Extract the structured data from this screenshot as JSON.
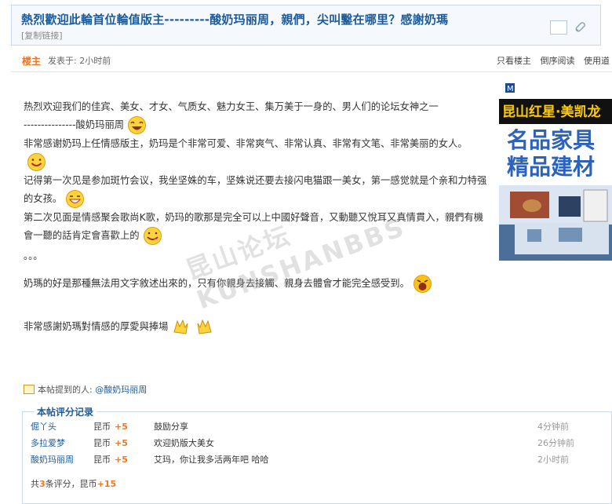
{
  "thread": {
    "title": "熱烈歡迎此輪首位輪值版主---------酸奶玛丽周，親們，尖叫鑿在哪里？感謝奶瑪",
    "copy_link": "[复制链接]"
  },
  "post": {
    "author_label": "楼主",
    "time": "发表于: 2小时前",
    "actions": [
      "只看楼主",
      "倒序阅读",
      "使用道"
    ],
    "paragraphs": [
      "热烈欢迎我们的佳宾、美女、才女、气质女、魅力女王、集万美于一身的、男人们的论坛女神之一",
      "---------------酸奶玛丽周",
      "非常感谢奶玛上任情感版主，奶玛是个非常可爱、非常爽气、非常认真、非常有文笔、非常美丽的女人。",
      "记得第一次见是参加斑竹会议，我坐坚姝的车，坚姝说还要去接闪电猫跟一美女，第一感觉就是个亲和力特强的女孩。",
      "第二次见面是情感聚会歌尚K歌，奶玛的歌那是完全可以上中國好聲音，又動聽又悅耳又真情貫入，親們有機會一聽的話肯定會喜歡上的",
      "。。。",
      "奶瑪的好是那種無法用文字敘述出來的，只有你親身去接觸、親身去體會才能完全感受到。",
      "非常感謝奶瑪對情感的厚愛與捧場"
    ],
    "mention_label": "本帖提到的人:",
    "mention_user": "@酸奶玛丽周"
  },
  "ad": {
    "brand": "M",
    "title": "昆山红星·美凯龙",
    "line1": "名品家具",
    "line2": "精品建材"
  },
  "watermark": "昆山论坛 KUNSHANBBS",
  "rating": {
    "title": "本帖评分记录",
    "rows": [
      {
        "user": "倔丫头",
        "currency": "昆币",
        "score": "+5",
        "reason": "鼓励分享",
        "time": "4分钟前"
      },
      {
        "user": "多拉爱梦",
        "currency": "昆币",
        "score": "+5",
        "reason": "欢迎奶版大美女",
        "time": "26分钟前"
      },
      {
        "user": "酸奶玛丽周",
        "currency": "昆币",
        "score": "+5",
        "reason": "艾玛，你让我多活两年吧 哈哈",
        "time": "2小时前"
      }
    ],
    "summary_prefix": "共",
    "summary_count": "3",
    "summary_mid": "条评分，昆币",
    "summary_total": "+15"
  }
}
